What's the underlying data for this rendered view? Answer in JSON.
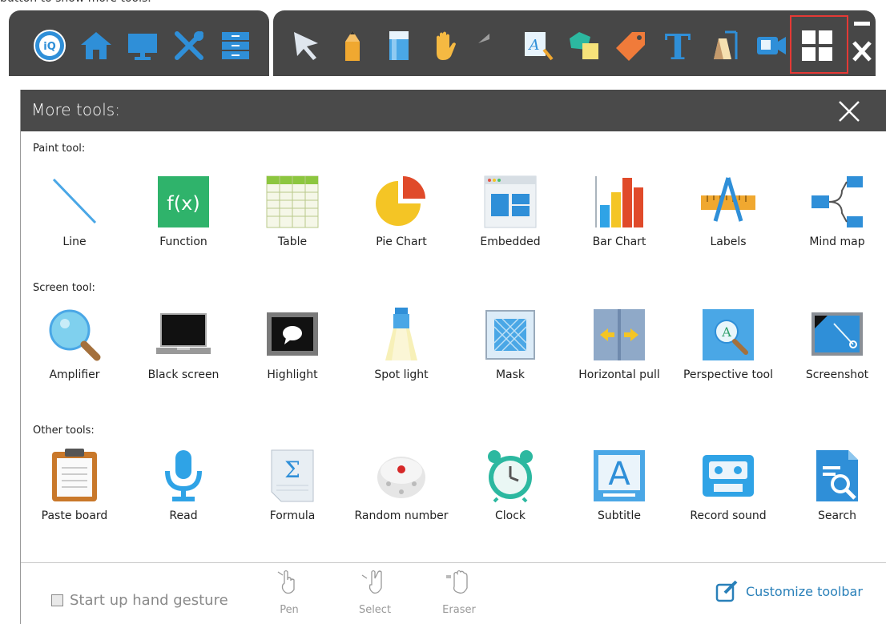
{
  "caption": "button to show more tools.",
  "toolbar": {
    "left_icons": [
      "iq-logo-icon",
      "home-icon",
      "monitor-icon",
      "tools-icon",
      "drawer-icon"
    ],
    "right_icons": [
      "cursor-icon",
      "pencil-icon",
      "eraser-icon",
      "hand-icon",
      "undo-icon",
      "text-recognize-icon",
      "shapes-icon",
      "tag-icon",
      "text-T-icon",
      "presenter-icon",
      "camera-icon",
      "more-tools-grid-icon",
      "close-icon"
    ]
  },
  "panel": {
    "title": "More tools:",
    "sections": [
      {
        "label": "Paint tool:",
        "tools": [
          {
            "name": "line",
            "label": "Line"
          },
          {
            "name": "function",
            "label": "Function",
            "icon_text": "f(x)"
          },
          {
            "name": "table",
            "label": "Table"
          },
          {
            "name": "pie-chart",
            "label": "Pie Chart"
          },
          {
            "name": "embedded",
            "label": "Embedded"
          },
          {
            "name": "bar-chart",
            "label": "Bar Chart"
          },
          {
            "name": "labels",
            "label": "Labels"
          },
          {
            "name": "mind-map",
            "label": "Mind  map"
          }
        ]
      },
      {
        "label": "Screen tool:",
        "tools": [
          {
            "name": "amplifier",
            "label": "Amplifier"
          },
          {
            "name": "black-screen",
            "label": "Black screen"
          },
          {
            "name": "highlight",
            "label": "Highlight"
          },
          {
            "name": "spot-light",
            "label": "Spot light"
          },
          {
            "name": "mask",
            "label": "Mask"
          },
          {
            "name": "horizontal-pull",
            "label": "Horizontal pull"
          },
          {
            "name": "perspective-tool",
            "label": "Perspective tool",
            "icon_text": "A"
          },
          {
            "name": "screenshot",
            "label": "Screenshot"
          }
        ]
      },
      {
        "label": "Other tools:",
        "tools": [
          {
            "name": "paste-board",
            "label": "Paste board"
          },
          {
            "name": "read",
            "label": "Read"
          },
          {
            "name": "formula",
            "label": "Formula",
            "icon_text": "Σ"
          },
          {
            "name": "random-number",
            "label": "Random number"
          },
          {
            "name": "clock",
            "label": "Clock"
          },
          {
            "name": "subtitle",
            "label": "Subtitle",
            "icon_text": "A"
          },
          {
            "name": "record-sound",
            "label": "Record sound"
          },
          {
            "name": "search",
            "label": "Search"
          }
        ]
      }
    ],
    "footer": {
      "gesture_label": "Start up hand gesture",
      "gesture_checked": false,
      "gestures": [
        {
          "name": "pen",
          "label": "Pen"
        },
        {
          "name": "select",
          "label": "Select"
        },
        {
          "name": "eraser",
          "label": "Eraser"
        }
      ],
      "customize_label": "Customize toolbar"
    }
  },
  "colors": {
    "toolbar_bg": "#474747",
    "header_bg": "#4a4a4a",
    "accent_blue": "#2f8fd8",
    "highlight_red": "#e53935",
    "link_blue": "#2980b9"
  }
}
